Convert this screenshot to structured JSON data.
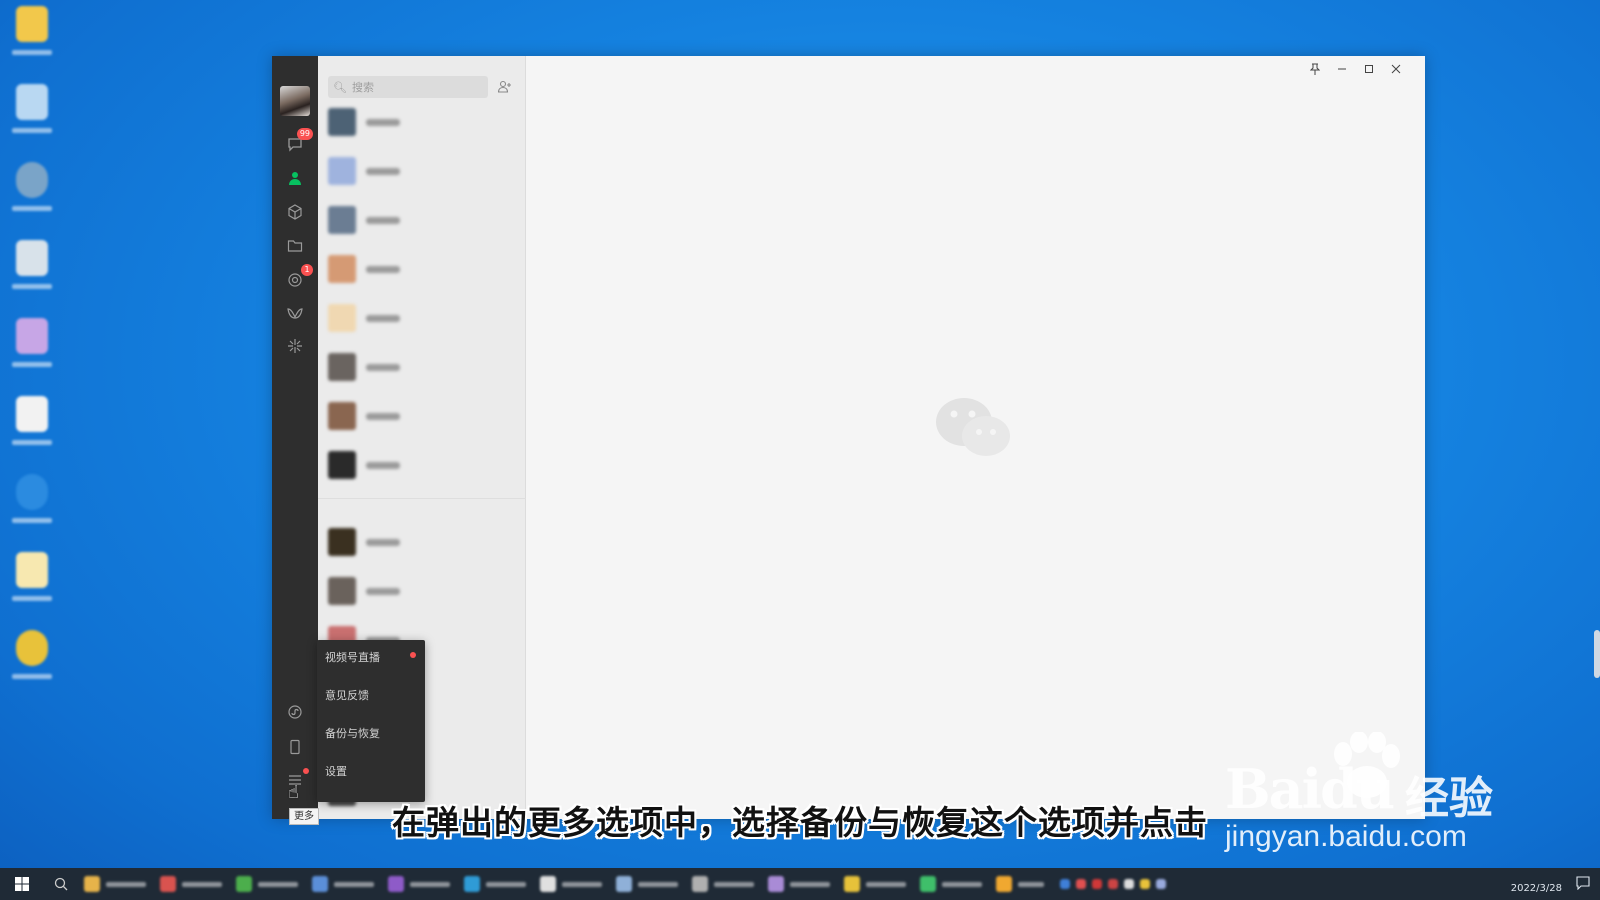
{
  "window": {
    "search_placeholder": "搜索",
    "badges": {
      "chats": "99",
      "moments": "1"
    }
  },
  "menu": {
    "items": [
      {
        "label": "视频号直播",
        "has_dot": true
      },
      {
        "label": "意见反馈"
      },
      {
        "label": "备份与恢复"
      },
      {
        "label": "设置"
      }
    ]
  },
  "tooltip": "更多",
  "subtitle": "在弹出的更多选项中，选择备份与恢复这个选项并点击",
  "watermark": {
    "brand": "Baidu",
    "brand_cn": "经验",
    "url": "jingyan.baidu.com"
  },
  "taskbar": {
    "date": "2022/3/28"
  },
  "colors": {
    "accent_green": "#07c160",
    "badge_red": "#fa5151",
    "rail": "#2e2e2e"
  },
  "icons": [
    "chat-icon",
    "contacts-icon",
    "favorites-icon",
    "files-icon",
    "moments-icon",
    "channels-icon",
    "discover-icon",
    "miniprogram-icon",
    "phone-icon",
    "more-icon"
  ]
}
